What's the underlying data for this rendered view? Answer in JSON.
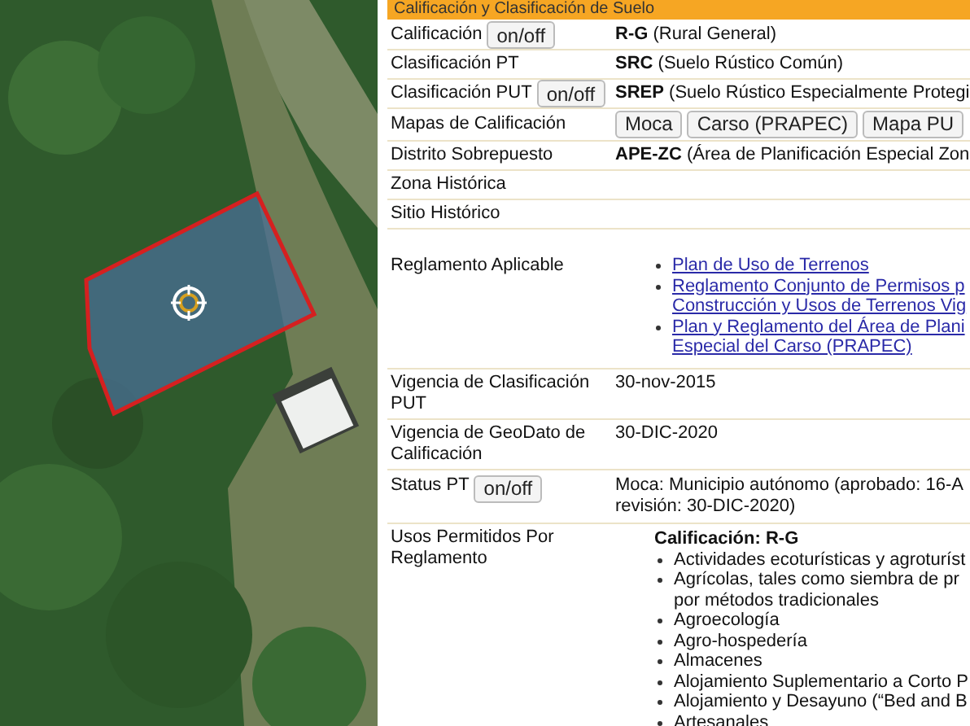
{
  "panel": {
    "header": "Calificación y Clasificación de Suelo",
    "rows": [
      {
        "kind": "text",
        "label": "Calificación",
        "button": "on/off",
        "value": [
          "**R-G** (Rural General)"
        ]
      },
      {
        "kind": "text",
        "label": "Clasificación PT",
        "value": [
          "**SRC** (Suelo Rústico Común)"
        ]
      },
      {
        "kind": "text",
        "label": "Clasificación PUT",
        "button": "on/off",
        "value": [
          "**SREP** (Suelo Rústico Especialmente Protegi"
        ]
      },
      {
        "kind": "buttons",
        "label": "Mapas de Calificación",
        "buttons": [
          "Moca",
          "Carso (PRAPEC)",
          "Mapa PU"
        ]
      },
      {
        "kind": "text",
        "label": "Distrito Sobrepuesto",
        "value": [
          "**APE-ZC** (Área de Planificación Especial Zon"
        ]
      },
      {
        "kind": "text",
        "label": "Zona Histórica"
      },
      {
        "kind": "text",
        "label": "Sitio Histórico"
      },
      {
        "kind": "links",
        "label": "Reglamento Aplicable",
        "links": [
          [
            "Plan de Uso de Terrenos"
          ],
          [
            "Reglamento Conjunto de Permisos p",
            "Construcción y Usos de Terrenos Vig"
          ],
          [
            "Plan y Reglamento del Área de Plani",
            "Especial del Carso (PRAPEC)"
          ]
        ]
      },
      {
        "kind": "text",
        "label": "Vigencia de Clasificación PUT",
        "value": [
          "30-nov-2015"
        ]
      },
      {
        "kind": "text",
        "label": "Vigencia de GeoDato de Calificación",
        "value": [
          "30-DIC-2020"
        ]
      },
      {
        "kind": "text",
        "label": "Status PT",
        "button": "on/off",
        "value": [
          "Moca: Municipio autónomo (aprobado: 16-A",
          "revisión: 30-DIC-2020)"
        ]
      },
      {
        "kind": "list",
        "label": "Usos Permitidos Por Reglamento",
        "heading": "Calificación: R-G",
        "items": [
          [
            "Actividades ecoturísticas y agroturíst"
          ],
          [
            "Agrícolas, tales como siembra de pr",
            "por métodos tradicionales"
          ],
          [
            "Agroecología"
          ],
          [
            "Agro-hospedería"
          ],
          [
            "Almacenes"
          ],
          [
            "Alojamiento Suplementario a Corto P"
          ],
          [
            "Alojamiento y Desayuno (“Bed and B"
          ],
          [
            "Artesanales"
          ]
        ]
      }
    ]
  }
}
